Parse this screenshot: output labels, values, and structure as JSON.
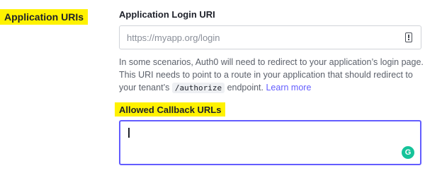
{
  "section": {
    "title": "Application URIs"
  },
  "login_uri": {
    "label": "Application Login URI",
    "placeholder": "https://myapp.org/login",
    "value": ""
  },
  "help": {
    "text_1": "In some scenarios, Auth0 will need to redirect to your application’s login page. This URI needs to point to a route in your application that should redirect to your tenant’s",
    "code": "/authorize",
    "text_2": "endpoint.",
    "link": "Learn more"
  },
  "callback_urls": {
    "label": "Allowed Callback URLs",
    "value": ""
  },
  "icons": {
    "login_field_icon": "info-box-icon",
    "grammarly_icon": "grammarly-icon",
    "grammarly_glyph": "G",
    "grammarly_color": "#15c39a"
  },
  "colors": {
    "highlight": "#fff200",
    "accent": "#635dff",
    "text": "#1e212a",
    "muted": "#5c616b"
  }
}
